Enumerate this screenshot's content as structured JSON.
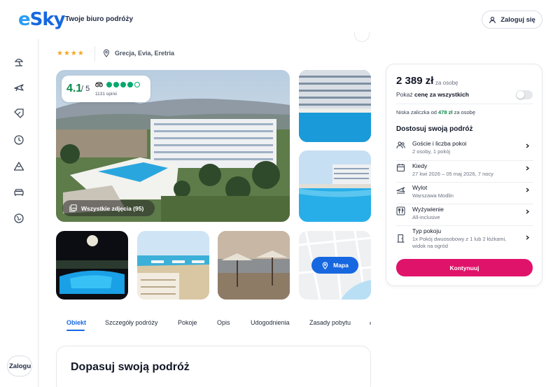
{
  "header": {
    "logo": "eSky",
    "tagline": "Twoje biuro podróży",
    "login_label": "Zaloguj się"
  },
  "rail": {
    "icons": [
      "beach-umbrella-icon",
      "plane-icon",
      "percent-tag-icon",
      "clock-icon",
      "mountain-icon",
      "bed-icon",
      "globe-icon"
    ],
    "login_label": "Zalogu"
  },
  "hotel": {
    "stars": "★★★★",
    "star_count": 4,
    "location": "Grecja, Evia, Eretria"
  },
  "rating": {
    "value": "4.1",
    "max": "/ 5",
    "reviews": "1131 opinii",
    "filled_dots": 4,
    "total_dots": 5
  },
  "gallery": {
    "all_photos_label": "Wszystkie zdjęcia (95)",
    "map_label": "Mapa"
  },
  "tabs": [
    "Obiekt",
    "Szczegóły podróży",
    "Pokoje",
    "Opis",
    "Udogodnienia",
    "Zasady pobytu"
  ],
  "active_tab": "Obiekt",
  "customize_section_title": "Dopasuj swoją podróż",
  "booking": {
    "price": "2 389 zł",
    "price_unit": "za osobę",
    "total_label_prefix": "Pokaż",
    "total_label_bold": "cenę za wszystkich",
    "toggle_on": false,
    "deposit_prefix": "Niska zaliczka od",
    "deposit_amount": "478 zł",
    "deposit_suffix": "za osobę",
    "customize_title": "Dostosuj swoją podróż",
    "options": [
      {
        "icon": "guests-icon",
        "label": "Goście i liczba pokoi",
        "value": "2 osoby, 1 pokój"
      },
      {
        "icon": "calendar-icon",
        "label": "Kiedy",
        "value": "27 kwi 2026 – 05 maj 2026, 7 nocy"
      },
      {
        "icon": "plane-departure-icon",
        "label": "Wylot",
        "value": "Warszawa Modlin"
      },
      {
        "icon": "cutlery-icon",
        "label": "Wyżywienie",
        "value": "All-inclusive"
      },
      {
        "icon": "door-icon",
        "label": "Typ pokoju",
        "value": "1x Pokój dwuosobowy z 1 lub 2 łóżkami, widok na ogród"
      }
    ],
    "continue_label": "Kontynuuj"
  },
  "colors": {
    "brand_blue": "#1768e0",
    "cta_pink": "#e0136b",
    "rating_green": "#0a8a4a",
    "star_orange": "#f5a623"
  }
}
